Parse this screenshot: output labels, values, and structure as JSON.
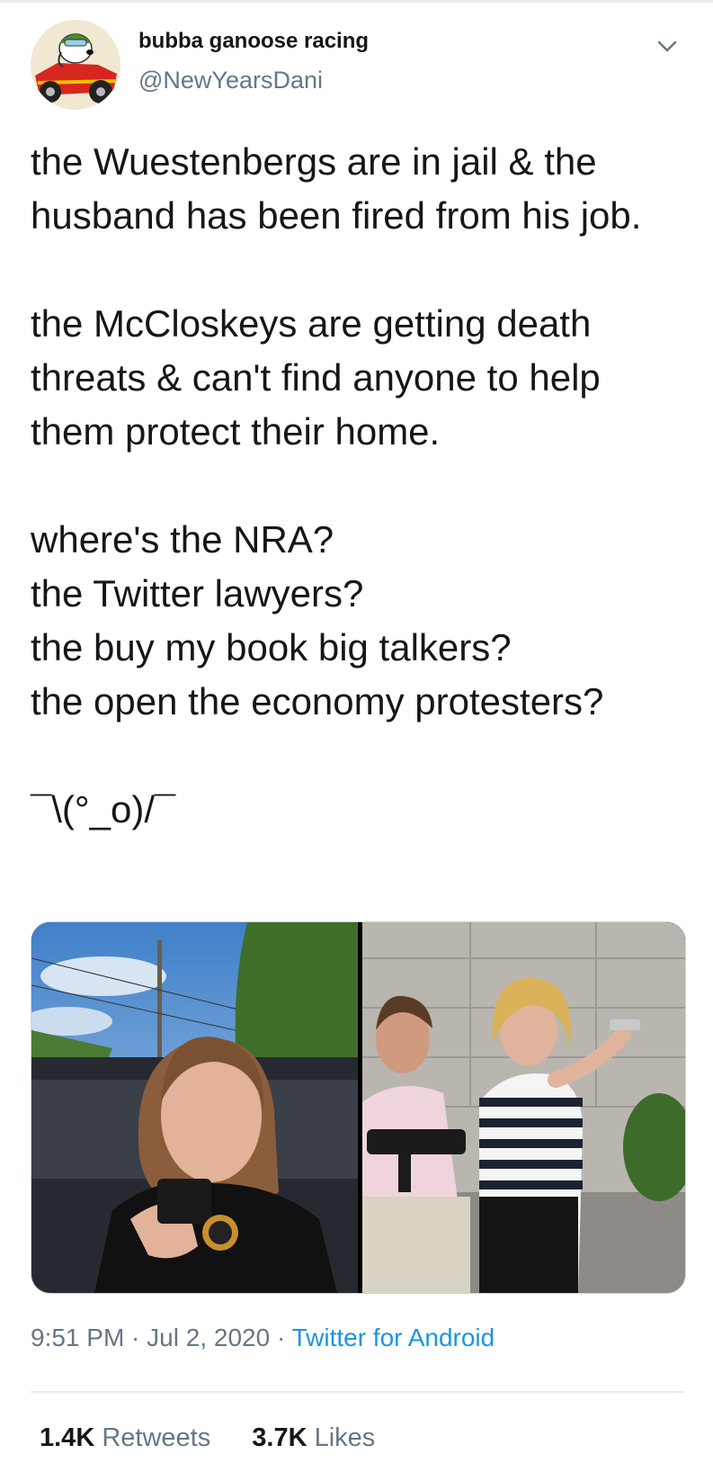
{
  "user": {
    "display_name": "bubba ganoose racing",
    "handle": "@NewYearsDani",
    "avatar_icon": "snoopy-race-car-avatar"
  },
  "tweet": {
    "paragraphs": [
      "the Wuestenbergs are in jail & the husband has been fired from his job.",
      "the McCloskeys are getting death threats & can't find anyone to help them protect their home.",
      "where's the NRA?\nthe Twitter lawyers?\nthe buy my book big talkers?\nthe open the economy protesters?",
      "¯\\(°_o)/¯"
    ]
  },
  "media": {
    "count": 2
  },
  "meta": {
    "time": "9:51 PM",
    "separator1": " · ",
    "date": "Jul 2, 2020",
    "separator2": " · ",
    "source": "Twitter for Android"
  },
  "stats": {
    "retweets_count": "1.4K",
    "retweets_label": "Retweets",
    "likes_count": "3.7K",
    "likes_label": "Likes"
  },
  "colors": {
    "text": "#14171a",
    "secondary": "#657786",
    "link": "#1b95e0",
    "divider": "#e6ecf0"
  }
}
